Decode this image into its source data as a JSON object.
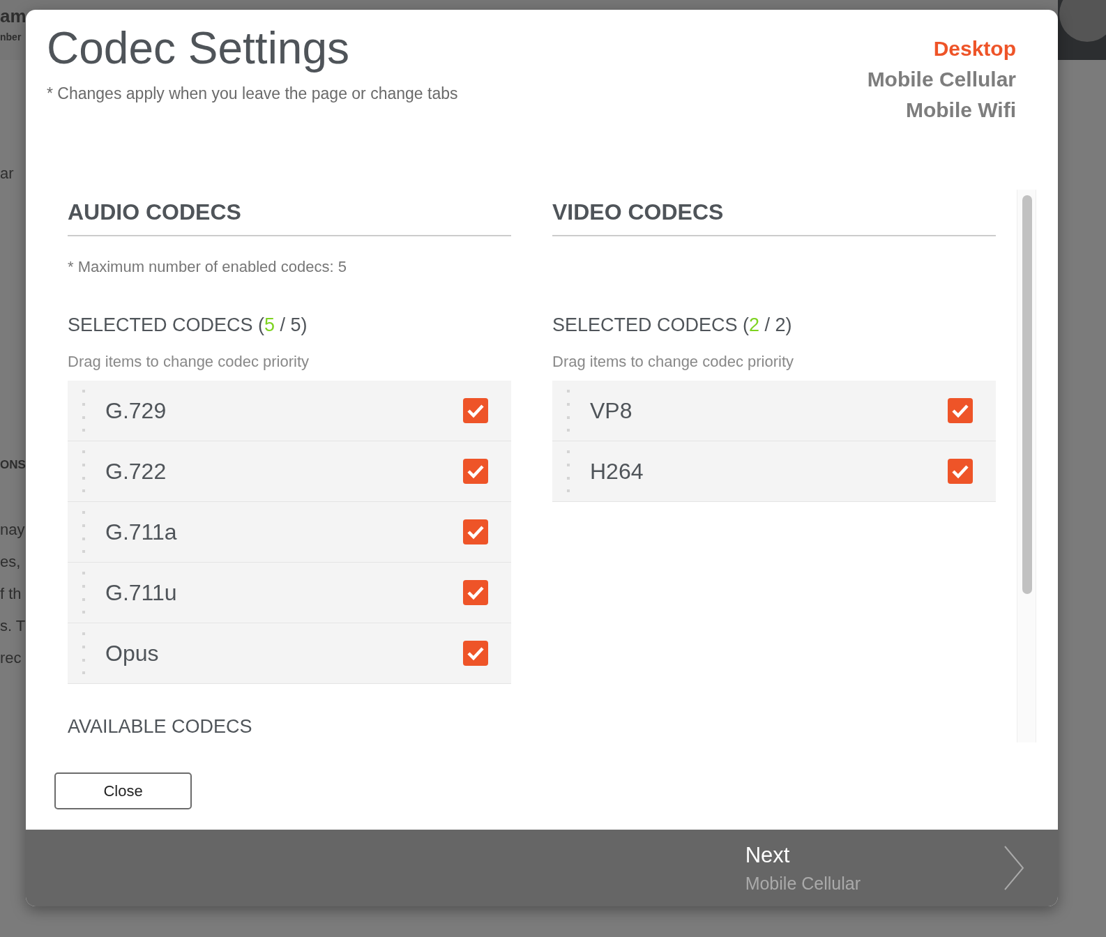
{
  "background_page": {
    "fragments": [
      {
        "text": "am",
        "kind": "title"
      },
      {
        "text": "nber",
        "kind": "subtitle"
      },
      {
        "text": "ar",
        "kind": "body"
      },
      {
        "text": "ONS",
        "kind": "heading"
      },
      {
        "text": "nay",
        "kind": "body"
      },
      {
        "text": "es,",
        "kind": "body"
      },
      {
        "text": "f th",
        "kind": "body"
      },
      {
        "text": "s. T",
        "kind": "body"
      },
      {
        "text": "rec",
        "kind": "body"
      }
    ]
  },
  "dialog": {
    "title": "Codec Settings",
    "note": "* Changes apply when you leave the page or change tabs",
    "profiles": [
      {
        "label": "Desktop",
        "selected": true
      },
      {
        "label": "Mobile Cellular",
        "selected": false
      },
      {
        "label": "Mobile Wifi",
        "selected": false
      }
    ],
    "sections": [
      {
        "title": "AUDIO CODECS",
        "note": "* Maximum number of enabled codecs: 5",
        "selected_heading_prefix": "SELECTED CODECS (",
        "selected_count": "5",
        "selected_heading_suffix": " / 5)",
        "hint": "Drag items to change codec priority",
        "codecs": [
          {
            "name": "G.729",
            "checked": true
          },
          {
            "name": "G.722",
            "checked": true
          },
          {
            "name": "G.711a",
            "checked": true
          },
          {
            "name": "G.711u",
            "checked": true
          },
          {
            "name": "Opus",
            "checked": true
          }
        ],
        "available_heading": "AVAILABLE CODECS"
      },
      {
        "title": "VIDEO CODECS",
        "selected_heading_prefix": "SELECTED CODECS (",
        "selected_count": "2",
        "selected_heading_suffix": " / 2)",
        "hint": "Drag items to change codec priority",
        "codecs": [
          {
            "name": "VP8",
            "checked": true
          },
          {
            "name": "H264",
            "checked": true
          }
        ]
      }
    ],
    "close_button": "Close",
    "next": {
      "label": "Next",
      "target": "Mobile Cellular"
    }
  }
}
